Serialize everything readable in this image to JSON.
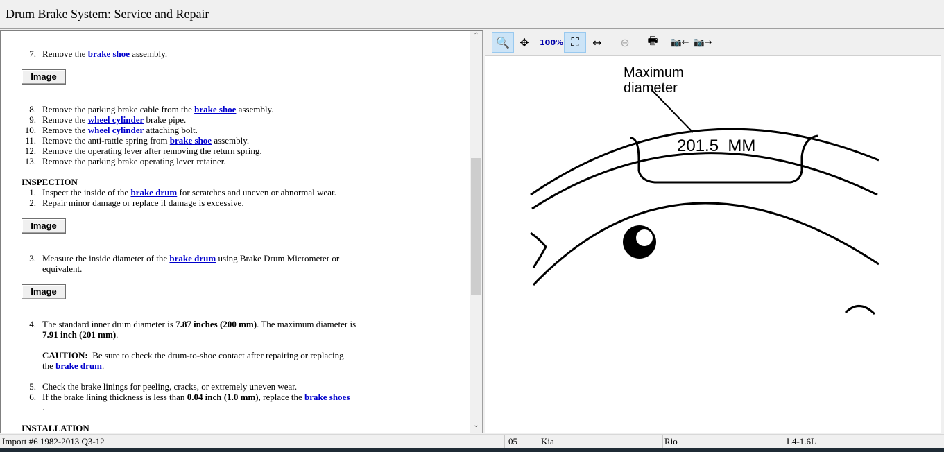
{
  "title": "Drum Brake System:  Service and Repair",
  "image_button_label": "Image",
  "steps_a": [
    {
      "num": "7.",
      "segs": [
        {
          "t": "Remove the "
        },
        {
          "t": "brake shoe",
          "link": 1
        },
        {
          "t": " assembly."
        }
      ]
    }
  ],
  "steps_b": [
    {
      "num": "8.",
      "segs": [
        {
          "t": "Remove the parking brake cable from the "
        },
        {
          "t": "brake shoe",
          "link": 1
        },
        {
          "t": " assembly."
        }
      ]
    },
    {
      "num": "9.",
      "segs": [
        {
          "t": "Remove the "
        },
        {
          "t": "wheel cylinder",
          "link": 1
        },
        {
          "t": " brake pipe."
        }
      ]
    },
    {
      "num": "10.",
      "segs": [
        {
          "t": "Remove the "
        },
        {
          "t": "wheel cylinder",
          "link": 1
        },
        {
          "t": " attaching bolt."
        }
      ]
    },
    {
      "num": "11.",
      "segs": [
        {
          "t": "Remove the anti-rattle spring from "
        },
        {
          "t": "brake shoe",
          "link": 1
        },
        {
          "t": " assembly."
        }
      ]
    },
    {
      "num": "12.",
      "segs": [
        {
          "t": "Remove the operating lever after removing the return spring."
        }
      ]
    },
    {
      "num": "13.",
      "segs": [
        {
          "t": "Remove the parking brake operating lever retainer."
        }
      ]
    }
  ],
  "inspection_heading": "INSPECTION",
  "steps_c": [
    {
      "num": "1.",
      "segs": [
        {
          "t": "Inspect the inside of the "
        },
        {
          "t": "brake drum",
          "link": 1
        },
        {
          "t": " for scratches and uneven or abnormal wear."
        }
      ]
    },
    {
      "num": "2.",
      "segs": [
        {
          "t": "Repair minor damage or replace if damage is excessive."
        }
      ]
    }
  ],
  "steps_d": [
    {
      "num": "3.",
      "segs": [
        {
          "t": "Measure the inside diameter of the "
        },
        {
          "t": "brake drum",
          "link": 1
        },
        {
          "t": " using Brake Drum Micrometer or"
        }
      ]
    },
    {
      "num": "",
      "segs": [
        {
          "t": "equivalent."
        }
      ]
    }
  ],
  "steps_e": [
    {
      "num": "4.",
      "segs": [
        {
          "t": "The standard inner drum diameter is "
        },
        {
          "t": "7.87 inches (200 mm)",
          "b": 1
        },
        {
          "t": ". The maximum diameter is"
        }
      ]
    },
    {
      "num": "",
      "segs": [
        {
          "t": "7.91 inch (201 mm)",
          "b": 1
        },
        {
          "t": "."
        }
      ]
    },
    {
      "num": "",
      "segs": []
    },
    {
      "num": "",
      "segs": [
        {
          "t": "CAUTION:",
          "b": 1
        },
        {
          "t": "  Be sure to check the drum-to-shoe contact after repairing or replacing"
        }
      ]
    },
    {
      "num": "",
      "segs": [
        {
          "t": "the "
        },
        {
          "t": "brake drum",
          "link": 1
        },
        {
          "t": "."
        }
      ]
    },
    {
      "num": "",
      "segs": []
    },
    {
      "num": "5.",
      "segs": [
        {
          "t": "Check the brake linings for peeling, cracks, or extremely uneven wear."
        }
      ]
    },
    {
      "num": "6.",
      "segs": [
        {
          "t": "If the brake lining thickness is less than "
        },
        {
          "t": "0.04 inch (1.0 mm)",
          "b": 1
        },
        {
          "t": ", replace the "
        },
        {
          "t": "brake shoes",
          "link": 1
        }
      ]
    },
    {
      "num": "",
      "segs": [
        {
          "t": "."
        }
      ]
    }
  ],
  "installation_heading": "INSTALLATION",
  "diagram": {
    "label_line1": "Maximum",
    "label_line2": "diameter",
    "value": "201.5  MM"
  },
  "status": {
    "source": "Import #6 1982-2013 Q3-12",
    "year": "05",
    "make": "Kia",
    "model": "Rio",
    "engine": "L4-1.6L"
  }
}
